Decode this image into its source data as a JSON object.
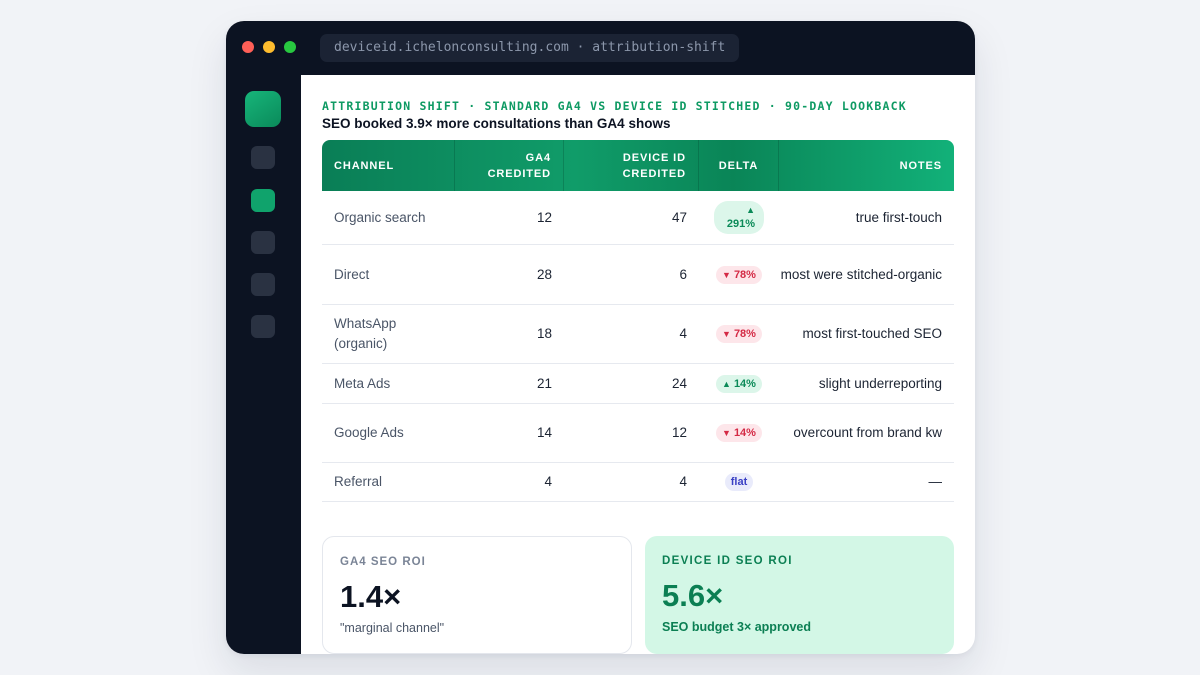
{
  "window": {
    "url": "deviceid.ichelonconsulting.com · attribution-shift"
  },
  "report": {
    "eyebrow": "ATTRIBUTION SHIFT · STANDARD GA4 VS DEVICE ID STITCHED · 90-DAY LOOKBACK",
    "headline": "SEO booked 3.9× more consultations than GA4 shows"
  },
  "table": {
    "headers": {
      "channel": "CHANNEL",
      "ga4": "GA4\nCREDITED",
      "device": "DEVICE ID\nCREDITED",
      "delta": "DELTA",
      "notes": "NOTES"
    },
    "rows": [
      {
        "channel": "Organic search",
        "ga4": "12",
        "device": "47",
        "delta": "291%",
        "direction": "up",
        "notes": "true first-touch"
      },
      {
        "channel": "Direct",
        "ga4": "28",
        "device": "6",
        "delta": "78%",
        "direction": "down",
        "notes": "most were stitched-organic"
      },
      {
        "channel": "WhatsApp (organic)",
        "ga4": "18",
        "device": "4",
        "delta": "78%",
        "direction": "down",
        "notes": "most first-touched SEO"
      },
      {
        "channel": "Meta Ads",
        "ga4": "21",
        "device": "24",
        "delta": "14%",
        "direction": "up",
        "notes": "slight underreporting"
      },
      {
        "channel": "Google Ads",
        "ga4": "14",
        "device": "12",
        "delta": "14%",
        "direction": "down",
        "notes": "overcount from brand kw"
      },
      {
        "channel": "Referral",
        "ga4": "4",
        "device": "4",
        "delta": "flat",
        "direction": "flat",
        "notes": "—"
      }
    ]
  },
  "cards": {
    "ga4": {
      "label": "GA4 SEO ROI",
      "value": "1.4×",
      "note": "\"marginal channel\""
    },
    "device": {
      "label": "DEVICE ID SEO ROI",
      "value": "5.6×",
      "note": "SEO budget 3× approved"
    }
  },
  "icons": {
    "up": "▲",
    "down": "▼"
  },
  "colors": {
    "accent": "#0e9a63",
    "up": "#0b8a58",
    "down": "#d42a45",
    "flat": "#3a40c4",
    "chrome": "#0c1322"
  }
}
